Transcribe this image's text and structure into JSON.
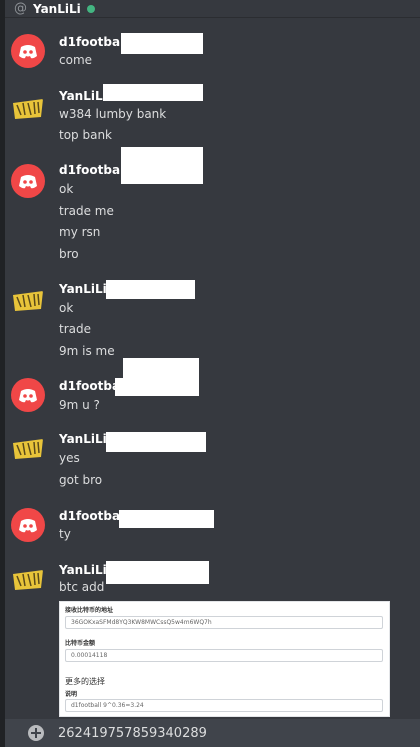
{
  "header": {
    "at_symbol": "@",
    "username": "YanLiLi",
    "status": "online"
  },
  "messages": [
    {
      "author": "d1football",
      "avatar": "discord-icon",
      "lines": [
        "come"
      ]
    },
    {
      "author": "YanLiLi",
      "avatar": "yanlili-logo",
      "lines": [
        "w384 lumby bank",
        "top bank"
      ]
    },
    {
      "author": "d1football",
      "avatar": "discord-icon",
      "lines": [
        "ok",
        "trade me",
        "my rsn",
        "bro"
      ]
    },
    {
      "author": "YanLiLi",
      "avatar": "yanlili-logo",
      "lines": [
        "ok",
        "trade",
        "9m is me"
      ]
    },
    {
      "author": "d1football",
      "avatar": "discord-icon",
      "lines": [
        "9m u ?"
      ]
    },
    {
      "author": "YanLiLi",
      "avatar": "yanlili-logo",
      "lines": [
        "yes",
        "got bro"
      ]
    },
    {
      "author": "d1football",
      "avatar": "discord-icon",
      "lines": [
        "ty"
      ]
    },
    {
      "author": "YanLiLi",
      "avatar": "yanlili-logo",
      "lines": [
        "btc add"
      ]
    }
  ],
  "embed": {
    "address_label": "接收比特币的地址",
    "address_value": "36GOKxaSFMd8YQ3KW8MWCssQ5w4m6WQ7h",
    "amount_label": "比特币金额",
    "amount_value": "0.00014118",
    "more_options": "更多的选择",
    "note_label": "说明",
    "note_value": "d1football   9^0.36=3.24"
  },
  "input": {
    "value": "262419757859340289"
  },
  "colors": {
    "background": "#36393f",
    "discord_red": "#f04747",
    "online_green": "#43b581"
  }
}
